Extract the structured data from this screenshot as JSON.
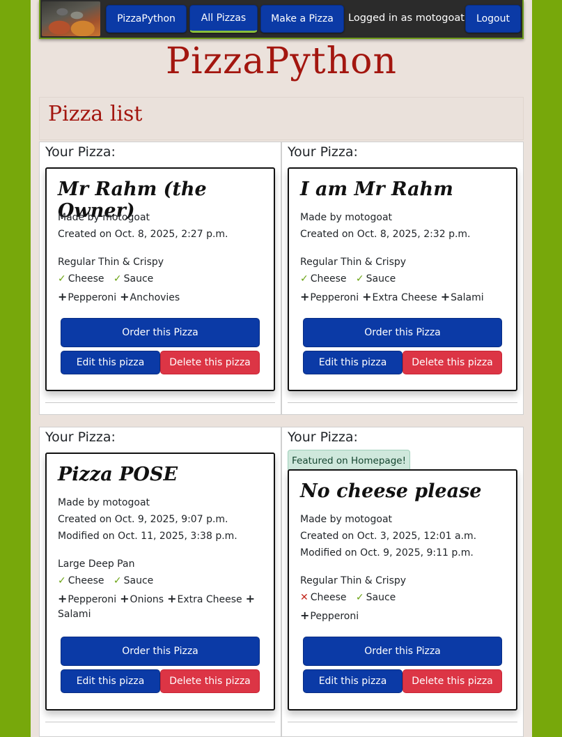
{
  "nav": {
    "logo_icon": "pizza-logo-image",
    "brand_btn": "PizzaPython",
    "all_pizzas": "All Pizzas",
    "make_pizza": "Make a Pizza",
    "user_text": "Logged in as motogoat",
    "logout": "Logout"
  },
  "brand": "PizzaPython",
  "list_title": "Pizza list",
  "pizzas": [
    {
      "label": "Your Pizza:",
      "title": "Mr Rahm (the Owner)",
      "made_by": "Made by motogoat",
      "created": "Created on Oct. 8, 2025, 2:27 p.m.",
      "base": "Regular Thin & Crispy",
      "cheese_mark": "✓",
      "cheese": "Cheese",
      "sauce_mark": "✓",
      "sauce": "Sauce",
      "toppings": [
        "Pepperoni",
        "Anchovies"
      ],
      "order": "Order this Pizza",
      "edit": "Edit this pizza",
      "delete": "Delete this pizza"
    },
    {
      "label": "Your Pizza:",
      "title": "I am Mr Rahm",
      "made_by": "Made by motogoat",
      "created": "Created on Oct. 8, 2025, 2:32 p.m.",
      "base": "Regular Thin & Crispy",
      "cheese_mark": "✓",
      "cheese": "Cheese",
      "sauce_mark": "✓",
      "sauce": "Sauce",
      "toppings": [
        "Pepperoni",
        "Extra Cheese",
        "Salami"
      ],
      "order": "Order this Pizza",
      "edit": "Edit this pizza",
      "delete": "Delete this pizza"
    },
    {
      "label": "Your Pizza:",
      "title": "Pizza POSE",
      "made_by": "Made by motogoat",
      "created": "Created on Oct. 9, 2025, 9:07 p.m.",
      "modified": "Modified on Oct. 11, 2025, 3:38 p.m.",
      "base": "Large Deep Pan",
      "cheese_mark": "✓",
      "cheese": "Cheese",
      "sauce_mark": "✓",
      "sauce": "Sauce",
      "toppings": [
        "Pepperoni",
        "Onions",
        "Extra Cheese",
        "Salami"
      ],
      "order": "Order this Pizza",
      "edit": "Edit this pizza",
      "delete": "Delete this pizza"
    },
    {
      "label": "Your Pizza:",
      "badge": "Featured on Homepage!",
      "title": "No cheese please",
      "made_by": "Made by motogoat",
      "created": "Created on Oct. 3, 2025, 12:01 a.m.",
      "modified": "Modified on Oct. 9, 2025, 9:11 p.m.",
      "base": "Regular Thin & Crispy",
      "cheese_mark": "✕",
      "cheese": "Cheese",
      "sauce_mark": "✓",
      "sauce": "Sauce",
      "toppings": [
        "Pepperoni"
      ],
      "order": "Order this Pizza",
      "edit": "Edit this pizza",
      "delete": "Delete this pizza"
    }
  ],
  "colors": {
    "background": "#77a80b",
    "brand_red": "#a3160f",
    "primary_button": "#0b3aa6",
    "delete_button": "#dc3545",
    "check_green": "#6aa313",
    "cross_red": "#c2251a"
  }
}
